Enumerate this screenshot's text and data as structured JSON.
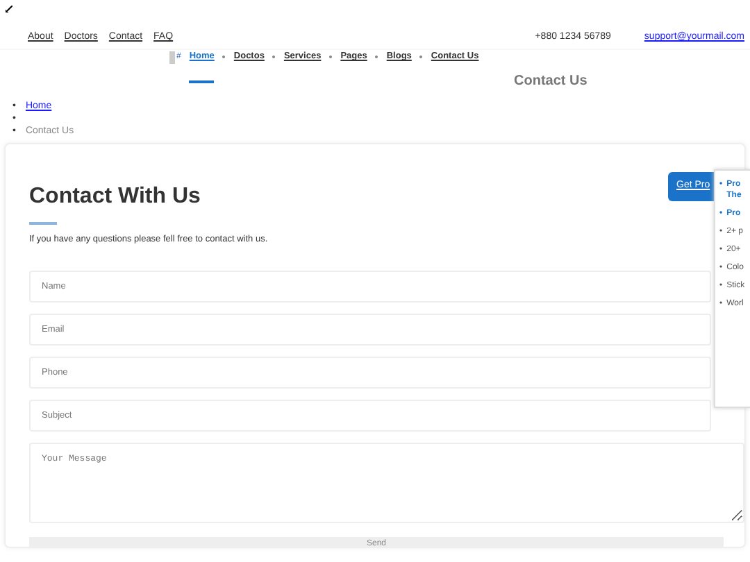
{
  "top_bar": {
    "links": [
      "About",
      "Doctors",
      "Contact",
      "FAQ"
    ],
    "phone": "+880 1234 56789",
    "email": "support@yourmail.com"
  },
  "nav": {
    "logo_alt": "#",
    "items": [
      {
        "label": "Home",
        "selected": true
      },
      {
        "label": "Doctos",
        "selected": false
      },
      {
        "label": "Services",
        "selected": false
      },
      {
        "label": "Pages",
        "selected": false
      },
      {
        "label": "Blogs",
        "selected": false
      },
      {
        "label": "Contact Us",
        "selected": false
      }
    ]
  },
  "page_title": "Contact Us",
  "breadcrumb": [
    {
      "marker": "•",
      "label": "Home",
      "link": true
    },
    {
      "marker": "•"
    },
    {
      "marker": "•",
      "label": "Contact Us",
      "link": false
    }
  ],
  "form": {
    "title": "Contact With Us",
    "subtitle": "If you have any questions please fell free to contact with us.",
    "fields": [
      {
        "placeholder": "Name",
        "kind": "input"
      },
      {
        "placeholder": "Email",
        "kind": "input"
      },
      {
        "placeholder": "Phone",
        "kind": "input"
      },
      {
        "placeholder": "Subject",
        "kind": "input"
      },
      {
        "placeholder": "Your Message",
        "kind": "textarea"
      }
    ],
    "submit": "Send"
  },
  "get_pro": {
    "button": "Get Pro",
    "features": [
      {
        "marker": "•",
        "label": "Pro The",
        "highlighted": true
      },
      {
        "marker": "•",
        "label": "Pro",
        "highlighted": true
      },
      {
        "marker": "•",
        "label": "2+ p",
        "highlighted": false
      },
      {
        "marker": "•",
        "label": "20+",
        "highlighted": false
      },
      {
        "marker": "•",
        "label": "Colo",
        "highlighted": false
      },
      {
        "marker": "•",
        "label": "Stick",
        "highlighted": false
      },
      {
        "marker": "•",
        "label": "Worl",
        "highlighted": false
      }
    ]
  }
}
